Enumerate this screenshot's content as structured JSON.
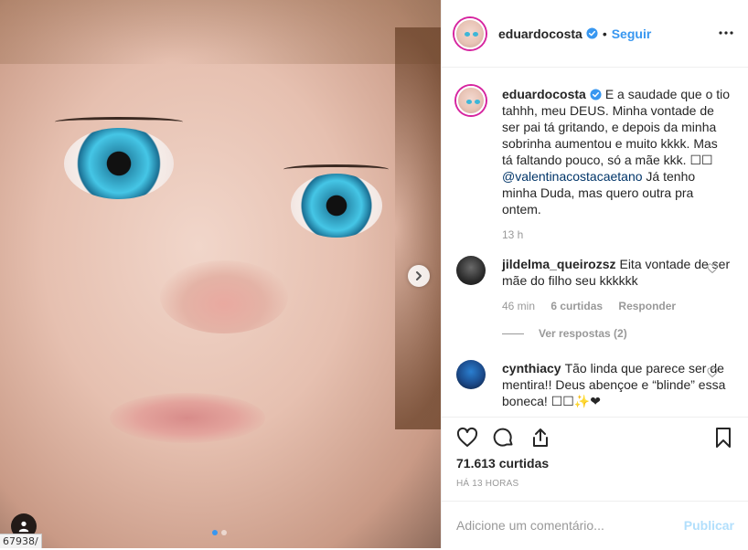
{
  "post": {
    "username": "eduardocosta",
    "follow_label": "Seguir",
    "separator": "•",
    "caption": "E a saudade que o tio tahhh, meu DEUS. Minha vontade de ser pai tá gritando, e depois da minha sobrinha aumentou e muito kkkk. Mas tá faltando pouco, só a mãe kkk. ☐☐ ",
    "caption_mention": "@valentinacostacaetano",
    "caption_end": " Já tenho minha Duda, mas quero outra pra ontem.",
    "caption_time": "13 h",
    "likes": "71.613 curtidas",
    "posted_ago": "HÁ 13 HORAS",
    "comment_placeholder": "Adicione um comentário...",
    "post_label": "Publicar"
  },
  "comments": [
    {
      "username": "jildelma_queirozsz",
      "text": "Eita vontade de ser mãe do filho seu kkkkkk",
      "time": "46 min",
      "likes": "6 curtidas",
      "reply": "Responder",
      "view_replies": "Ver respostas (2)"
    },
    {
      "username": "cynthiacy",
      "text": "Tão linda que parece ser de mentira!! Deus abençoe e “blinde” essa boneca! ☐☐✨❤"
    }
  ],
  "status_url": "67938/",
  "colors": {
    "accent": "#3897f0",
    "post_disabled": "#b2dffc",
    "muted": "#999999",
    "story_ring": "#d6249f"
  },
  "icons": [
    "more-icon",
    "verified-icon",
    "heart-icon",
    "comment-icon",
    "share-icon",
    "bookmark-icon",
    "next-arrow-icon",
    "user-tag-icon"
  ]
}
